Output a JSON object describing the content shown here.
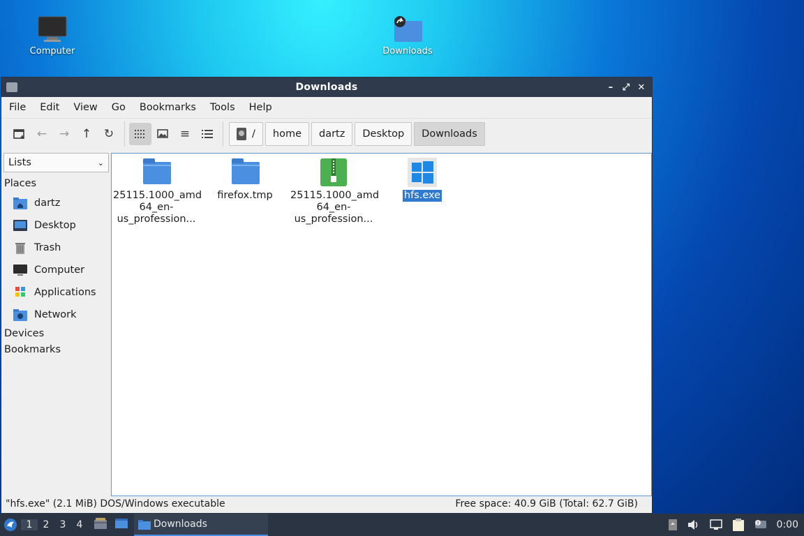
{
  "desktop": {
    "icons": [
      {
        "label": "Computer"
      },
      {
        "label": "Downloads"
      }
    ]
  },
  "window": {
    "title": "Downloads"
  },
  "menu": [
    "File",
    "Edit",
    "View",
    "Go",
    "Bookmarks",
    "Tools",
    "Help"
  ],
  "breadcrumbs": {
    "root": "/",
    "items": [
      "home",
      "dartz",
      "Desktop",
      "Downloads"
    ]
  },
  "sidebar": {
    "dropdown": "Lists",
    "places_heading": "Places",
    "places": [
      {
        "label": "dartz",
        "icon": "home-folder-icon"
      },
      {
        "label": "Desktop",
        "icon": "desktop-icon"
      },
      {
        "label": "Trash",
        "icon": "trash-icon"
      },
      {
        "label": "Computer",
        "icon": "computer-icon"
      },
      {
        "label": "Applications",
        "icon": "applications-icon"
      },
      {
        "label": "Network",
        "icon": "network-icon"
      }
    ],
    "devices_heading": "Devices",
    "bookmarks_heading": "Bookmarks"
  },
  "files": [
    {
      "name": "25115.1000_amd\n64_en-\nus_profession...",
      "icon": "folder-icon"
    },
    {
      "name": "firefox.tmp",
      "icon": "folder-icon"
    },
    {
      "name": "25115.1000_amd\n64_en-\nus_profession...",
      "icon": "archive-icon"
    },
    {
      "name": "hfs.exe",
      "icon": "windows-executable-icon",
      "selected": true
    }
  ],
  "status": {
    "left": "\"hfs.exe\" (2.1 MiB) DOS/Windows executable",
    "right": "Free space: 40.9 GiB (Total: 62.7 GiB)"
  },
  "taskbar": {
    "workspaces": [
      "1",
      "2",
      "3",
      "4"
    ],
    "active_workspace": "1",
    "task_label": "Downloads",
    "clock": "0:00"
  },
  "colors": {
    "accent": "#2f7ad0",
    "folder": "#4a8fe0",
    "titlebar": "#2f3a4c",
    "taskbar": "#2b3442",
    "archive": "#4caf50"
  }
}
